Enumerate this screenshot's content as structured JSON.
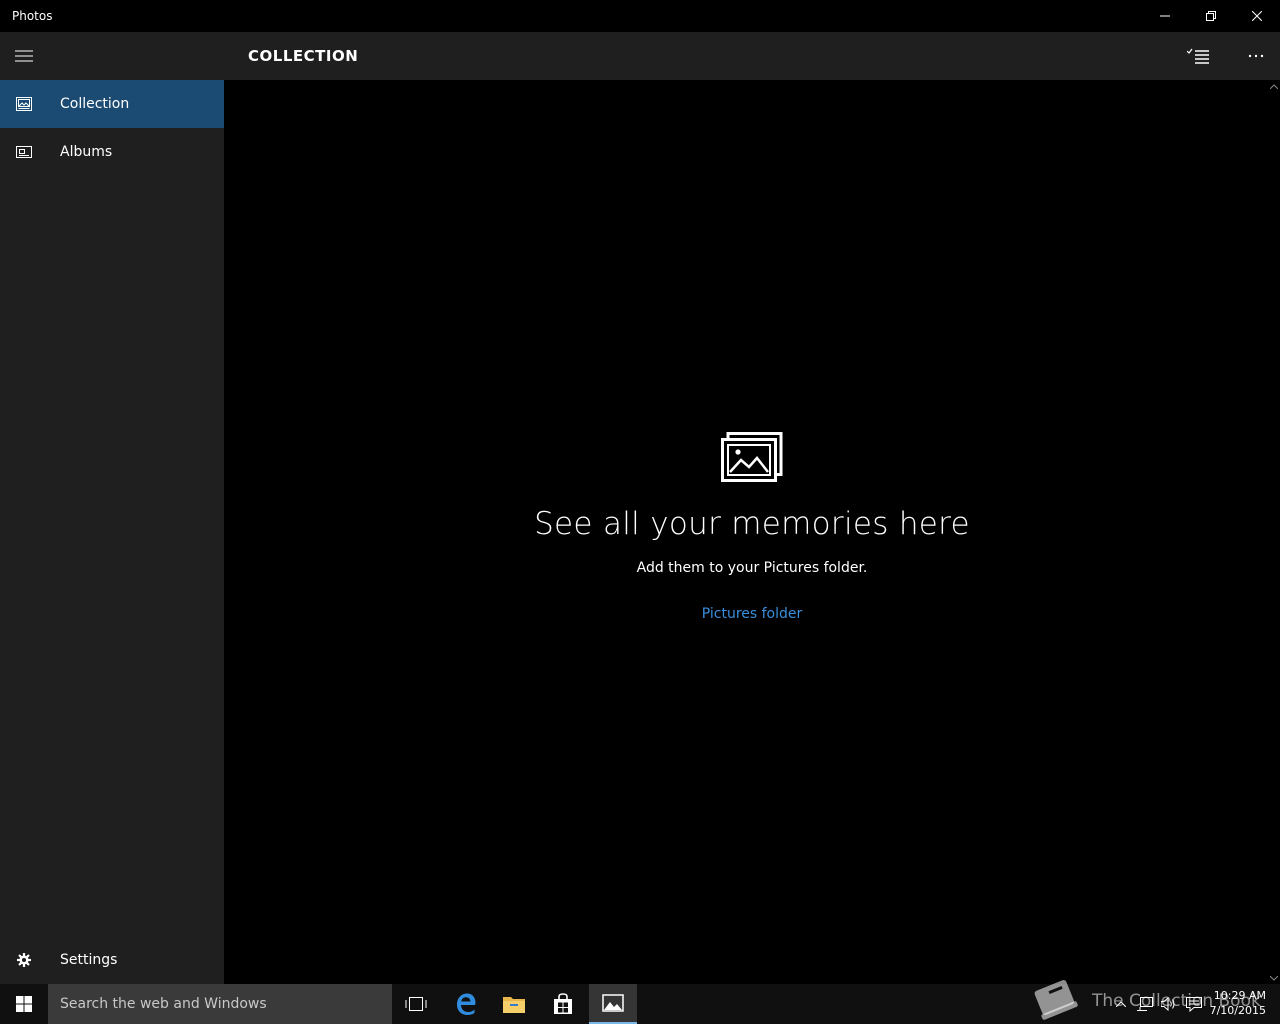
{
  "window": {
    "title": "Photos"
  },
  "nav": {
    "items": [
      {
        "label": "Collection",
        "icon": "collection-icon",
        "selected": true
      },
      {
        "label": "Albums",
        "icon": "album-icon",
        "selected": false
      }
    ],
    "settings_label": "Settings"
  },
  "header": {
    "title": "COLLECTION"
  },
  "empty_state": {
    "heading": "See all your memories here",
    "subtext": "Add them to your Pictures folder.",
    "link": "Pictures folder"
  },
  "taskbar": {
    "search_placeholder": "Search the web and Windows",
    "time": "10:29 AM",
    "date": "7/10/2015",
    "watermark": "The Collection Book"
  },
  "colors": {
    "selected_nav": "#1b4b72",
    "link": "#3a8fdc",
    "pane_bg": "#1f1f1f",
    "taskbar_active": "#79b8e6"
  }
}
